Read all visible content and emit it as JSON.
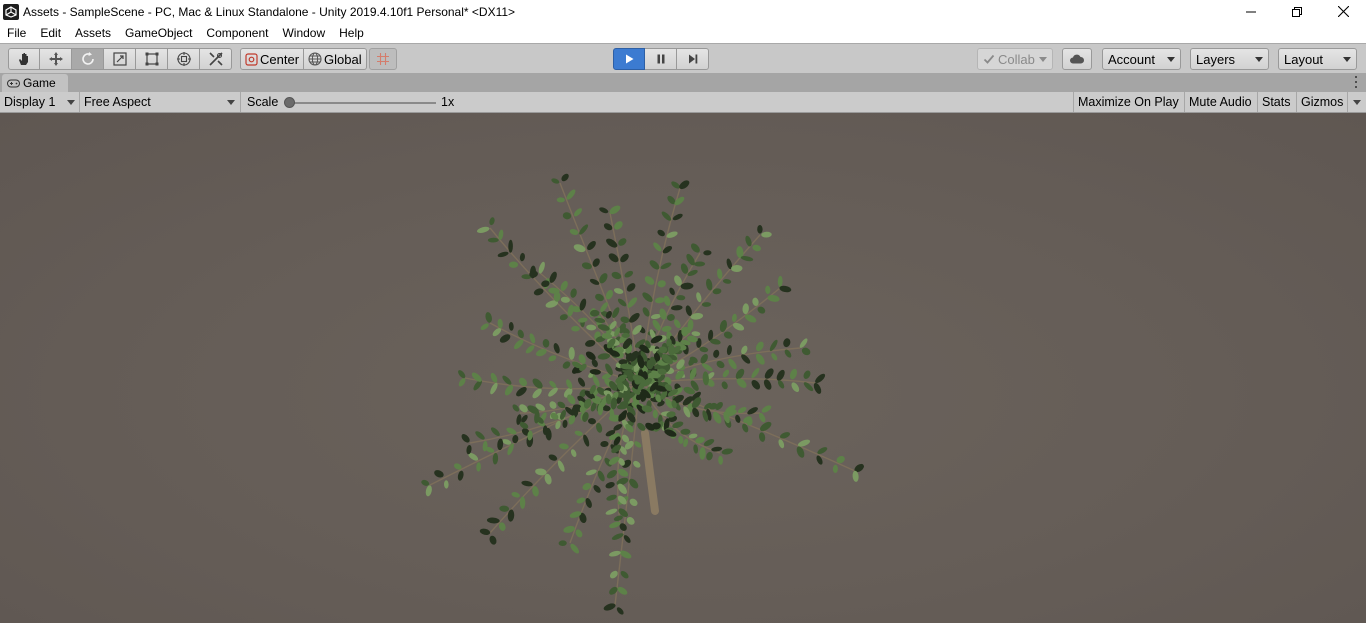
{
  "window": {
    "title": "Assets - SampleScene - PC, Mac & Linux Standalone - Unity 2019.4.10f1 Personal* <DX11>",
    "controls": [
      "minimize-icon",
      "restore-icon",
      "close-icon"
    ]
  },
  "menu": {
    "items": [
      "File",
      "Edit",
      "Assets",
      "GameObject",
      "Component",
      "Window",
      "Help"
    ]
  },
  "toolbar": {
    "transform_tools": [
      "hand-icon",
      "move-icon",
      "rotate-icon",
      "scale-icon",
      "rect-icon",
      "transform-icon",
      "custom-tool-icon"
    ],
    "active_tool": "rotate-icon",
    "pivot_label": "Center",
    "space_label": "Global",
    "play_controls": [
      "play-icon",
      "pause-icon",
      "step-icon"
    ],
    "playing": true,
    "collab_label": "Collab",
    "account_label": "Account",
    "layers_label": "Layers",
    "layout_label": "Layout"
  },
  "tab": {
    "label": "Game"
  },
  "game_view": {
    "display": "Display 1",
    "aspect": "Free Aspect",
    "scale_label": "Scale",
    "scale_value": "1x",
    "scale_fraction": 0.0,
    "toggles": {
      "maximize": "Maximize On Play",
      "mute": "Mute Audio",
      "stats": "Stats",
      "gizmos": "Gizmos"
    }
  },
  "colors": {
    "play_active": "#3c7bd1",
    "viewport_bg": "#665e58",
    "leaf_green": "#5a7d46",
    "toolbar_bg": "#c8c8c8"
  }
}
